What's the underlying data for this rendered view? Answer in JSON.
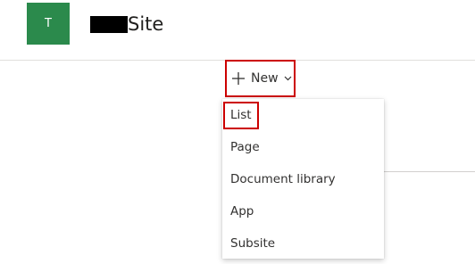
{
  "site": {
    "logo_letter": "T",
    "title_suffix": "Site"
  },
  "toolbar": {
    "new_label": "New"
  },
  "new_menu": {
    "items": [
      {
        "label": "List"
      },
      {
        "label": "Page"
      },
      {
        "label": "Document library"
      },
      {
        "label": "App"
      },
      {
        "label": "Subsite"
      }
    ]
  },
  "colors": {
    "logo_bg": "#2b8a4c",
    "highlight_border": "#cc0000"
  },
  "icons": {
    "new_button": "plus-icon",
    "new_dropdown": "chevron-down-icon"
  }
}
